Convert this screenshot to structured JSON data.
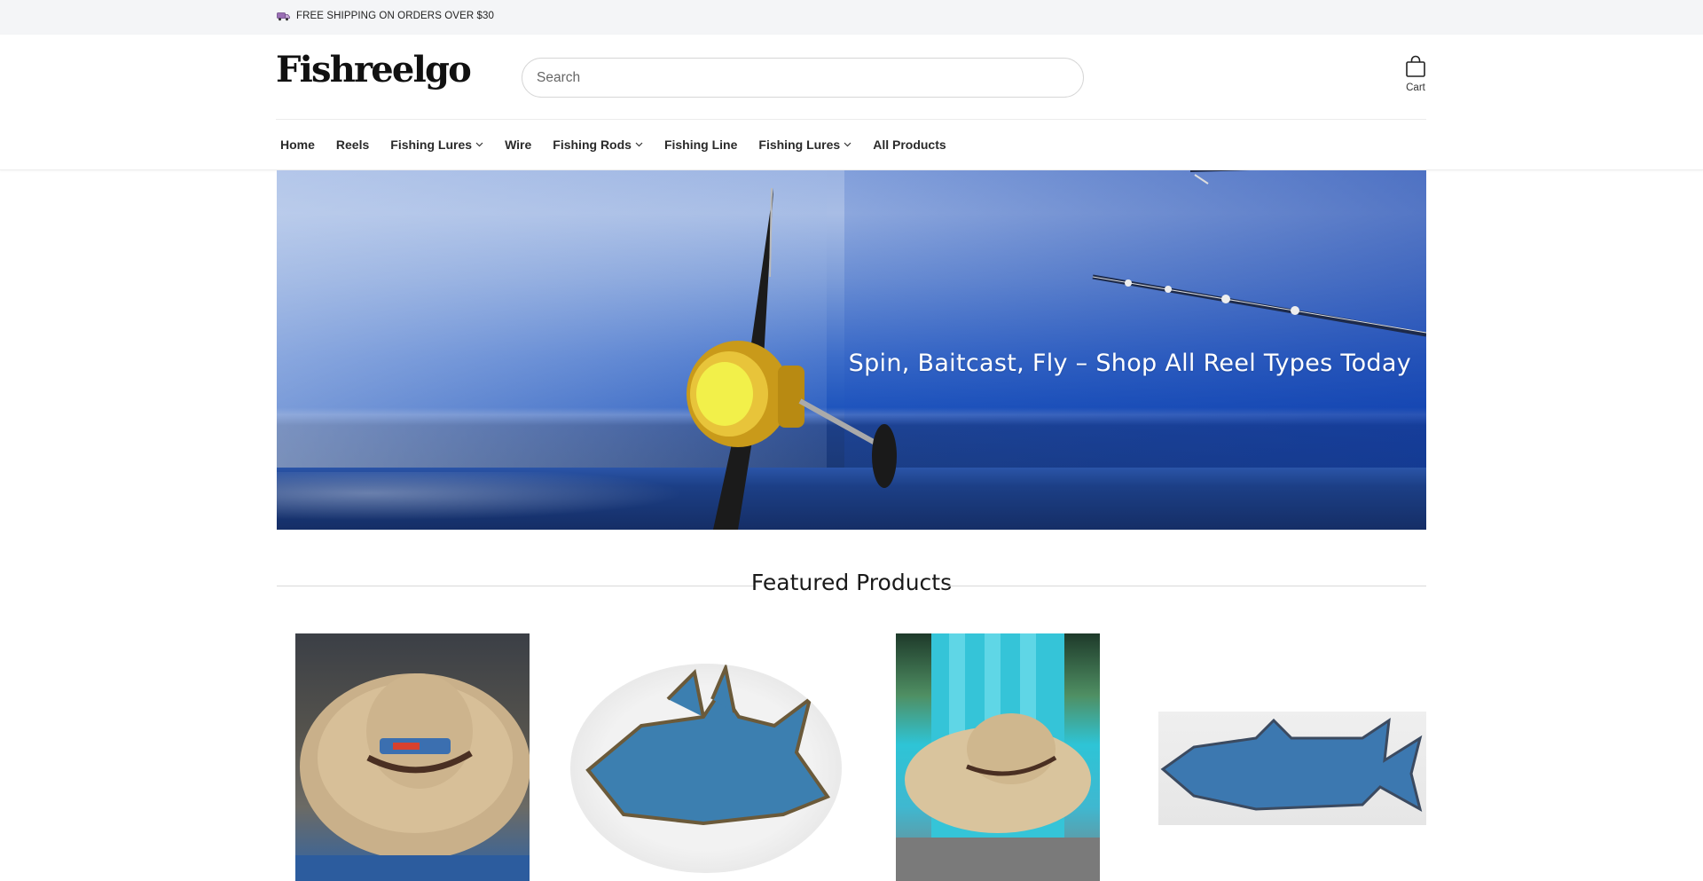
{
  "announcement": {
    "text": "FREE SHIPPING ON ORDERS OVER $30",
    "icon": "truck-icon"
  },
  "header": {
    "logo": "Fishreelgo",
    "search_placeholder": "Search",
    "cart_label": "Cart",
    "cart_icon": "shopping-bag-icon"
  },
  "nav": {
    "items": [
      {
        "label": "Home",
        "dropdown": false
      },
      {
        "label": "Reels",
        "dropdown": false
      },
      {
        "label": "Fishing Lures",
        "dropdown": true
      },
      {
        "label": "Wire",
        "dropdown": false
      },
      {
        "label": "Fishing Rods",
        "dropdown": true
      },
      {
        "label": "Fishing Line",
        "dropdown": false
      },
      {
        "label": "Fishing Lures",
        "dropdown": true
      },
      {
        "label": "All Products",
        "dropdown": false
      }
    ]
  },
  "hero": {
    "headline": "Spin, Baitcast, Fly  –  Shop All Reel Types Today"
  },
  "featured": {
    "title": "Featured Products",
    "products": [
      {
        "image": "straw hat with license plate fish patch"
      },
      {
        "image": "license plate hogfish cutout"
      },
      {
        "image": "straw hat on blue adirondack chair"
      },
      {
        "image": "license plate tarpon cutout"
      }
    ]
  },
  "colors": {
    "announcement_bg": "#f4f5f7",
    "text": "#121212",
    "hero_sea": "#1d3f87"
  }
}
